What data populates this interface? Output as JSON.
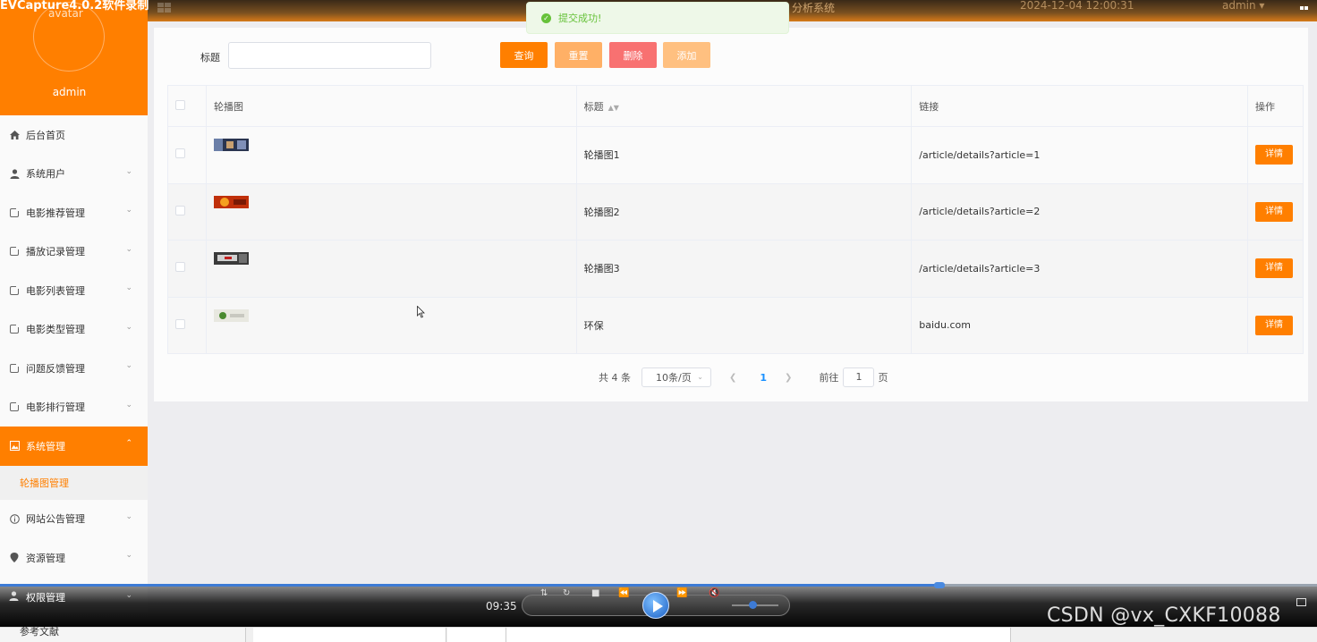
{
  "recorder": {
    "title": "EVCapture4.0.2软件录制"
  },
  "topbar": {
    "system_title": "分析系统",
    "clock": "2024-12-04 12:00:31",
    "user": "admin ▾"
  },
  "toast": {
    "message": "提交成功!"
  },
  "sidebar": {
    "avatar_alt": "avatar",
    "username": "admin",
    "items": [
      {
        "label": "后台首页",
        "icon": "home-icon"
      },
      {
        "label": "系统用户",
        "icon": "user-icon"
      },
      {
        "label": "电影推荐管理",
        "icon": "module-icon"
      },
      {
        "label": "播放记录管理",
        "icon": "module-icon"
      },
      {
        "label": "电影列表管理",
        "icon": "module-icon"
      },
      {
        "label": "电影类型管理",
        "icon": "module-icon"
      },
      {
        "label": "问题反馈管理",
        "icon": "module-icon"
      },
      {
        "label": "电影排行管理",
        "icon": "module-icon"
      },
      {
        "label": "系统管理",
        "icon": "picture-icon",
        "active": true
      },
      {
        "label": "网站公告管理",
        "icon": "info-icon"
      },
      {
        "label": "资源管理",
        "icon": "location-icon"
      },
      {
        "label": "权限管理",
        "icon": "user-icon"
      }
    ],
    "sub_item": "轮播图管理",
    "bottom_peek": "参考文献"
  },
  "search": {
    "label": "标题",
    "value": "",
    "placeholder": ""
  },
  "buttons": {
    "query": "查询",
    "reset": "重置",
    "delete": "删除",
    "add": "添加"
  },
  "table": {
    "headers": {
      "image": "轮播图",
      "title": "标题",
      "link": "链接",
      "action": "操作"
    },
    "rows": [
      {
        "title": "轮播图1",
        "link": "/article/details?article=1",
        "action": "详情"
      },
      {
        "title": "轮播图2",
        "link": "/article/details?article=2",
        "action": "详情"
      },
      {
        "title": "轮播图3",
        "link": "/article/details?article=3",
        "action": "详情"
      },
      {
        "title": "环保",
        "link": "baidu.com",
        "action": "详情"
      }
    ]
  },
  "pagination": {
    "total": "共 4 条",
    "page_size": "10条/页",
    "current": "1",
    "goto_label": "前往",
    "goto_value": "1",
    "page_unit": "页"
  },
  "player": {
    "time": "09:35",
    "progress": 0.713,
    "volume": 0.45
  },
  "watermark": "CSDN @vx_CXKF10088",
  "colors": {
    "accent": "#ff7f00",
    "danger": "#f87171",
    "success": "#67c23a",
    "link_blue": "#1890ff"
  }
}
